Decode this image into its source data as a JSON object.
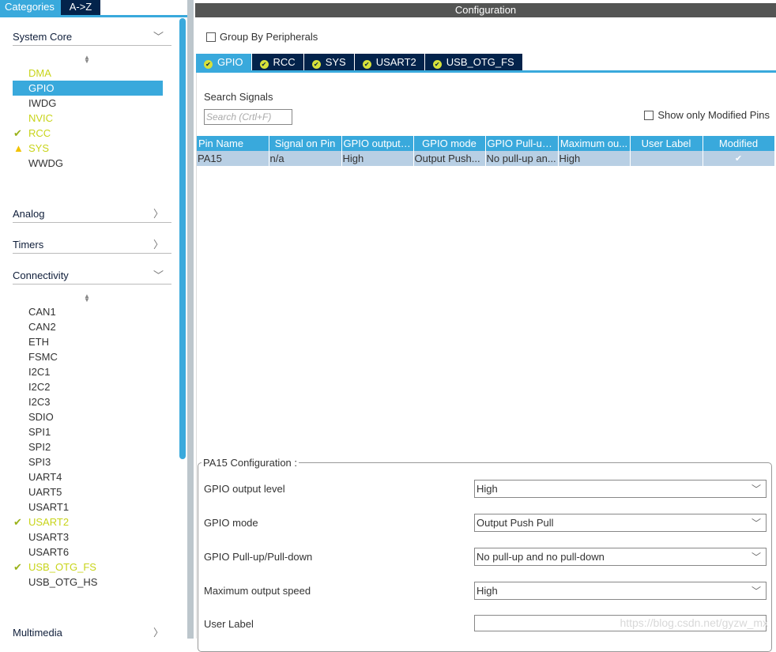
{
  "left": {
    "tabs": [
      {
        "label": "Categories",
        "active": true
      },
      {
        "label": "A->Z",
        "active": false
      }
    ],
    "sections": [
      {
        "label": "System Core",
        "expanded": true,
        "items": [
          {
            "label": "DMA",
            "state": "yellow"
          },
          {
            "label": "GPIO",
            "state": "selected"
          },
          {
            "label": "IWDG",
            "state": "normal"
          },
          {
            "label": "NVIC",
            "state": "yellow"
          },
          {
            "label": "RCC",
            "state": "check-icon"
          },
          {
            "label": "SYS",
            "state": "warning-icon"
          },
          {
            "label": "WWDG",
            "state": "normal"
          }
        ]
      },
      {
        "label": "Analog",
        "expanded": false
      },
      {
        "label": "Timers",
        "expanded": false
      },
      {
        "label": "Connectivity",
        "expanded": true,
        "items": [
          {
            "label": "CAN1"
          },
          {
            "label": "CAN2"
          },
          {
            "label": "ETH"
          },
          {
            "label": "FSMC"
          },
          {
            "label": "I2C1"
          },
          {
            "label": "I2C2"
          },
          {
            "label": "I2C3"
          },
          {
            "label": "SDIO"
          },
          {
            "label": "SPI1"
          },
          {
            "label": "SPI2"
          },
          {
            "label": "SPI3"
          },
          {
            "label": "UART4"
          },
          {
            "label": "UART5"
          },
          {
            "label": "USART1"
          },
          {
            "label": "USART2",
            "state": "check-icon"
          },
          {
            "label": "USART3"
          },
          {
            "label": "USART6"
          },
          {
            "label": "USB_OTG_FS",
            "state": "check-icon"
          },
          {
            "label": "USB_OTG_HS"
          }
        ]
      },
      {
        "label": "Multimedia",
        "expanded": false
      }
    ]
  },
  "config": {
    "title": "Configuration",
    "group_by": "Group By Peripherals",
    "tabs": [
      "GPIO",
      "RCC",
      "SYS",
      "USART2",
      "USB_OTG_FS"
    ],
    "search_label": "Search Signals",
    "search_placeholder": "Search (Crtl+F)",
    "show_modified": "Show only Modified Pins",
    "columns": [
      "Pin Name",
      "Signal on Pin",
      "GPIO output ...",
      "GPIO mode",
      "GPIO Pull-up...",
      "Maximum ou...",
      "User Label",
      "Modified"
    ],
    "rows": [
      [
        "PA15",
        "n/a",
        "High",
        "Output Push...",
        "No pull-up an...",
        "High",
        "",
        "✔"
      ]
    ],
    "pin_config": {
      "legend": "PA15 Configuration :",
      "fields": [
        {
          "label": "GPIO output level",
          "value": "High"
        },
        {
          "label": "GPIO mode",
          "value": "Output Push Pull"
        },
        {
          "label": "GPIO Pull-up/Pull-down",
          "value": "No pull-up and no pull-down"
        },
        {
          "label": "Maximum output speed",
          "value": "High"
        },
        {
          "label": "User Label",
          "value": ""
        }
      ]
    }
  },
  "watermark": "https://blog.csdn.net/gyzw_mx",
  "colors": {
    "accent": "#39a9dc",
    "navy": "#03234b",
    "yellow": "#c8d41a"
  }
}
